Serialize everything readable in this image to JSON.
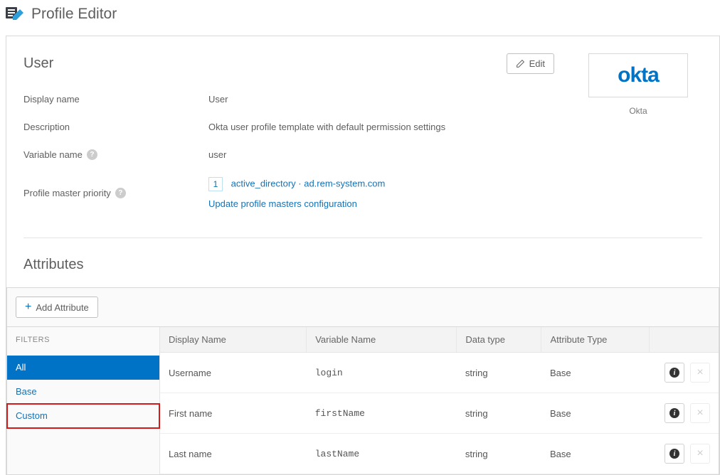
{
  "header": {
    "title": "Profile Editor"
  },
  "user": {
    "section_title": "User",
    "edit_label": "Edit",
    "fields": {
      "display_name_label": "Display name",
      "display_name_value": "User",
      "description_label": "Description",
      "description_value": "Okta user profile template with default permission settings",
      "variable_name_label": "Variable name",
      "variable_name_value": "user",
      "master_priority_label": "Profile master priority",
      "master_priority_num": "1",
      "master_priority_link": "active_directory · ad.rem-system.com",
      "master_priority_update": "Update profile masters configuration"
    }
  },
  "side": {
    "logo_text": "okta",
    "logo_caption": "Okta"
  },
  "attributes": {
    "title": "Attributes",
    "add_label": "Add Attribute",
    "filters_header": "FILTERS",
    "filters": [
      {
        "label": "All",
        "active": true,
        "highlighted": false
      },
      {
        "label": "Base",
        "active": false,
        "highlighted": false
      },
      {
        "label": "Custom",
        "active": false,
        "highlighted": true
      }
    ],
    "columns": {
      "display": "Display Name",
      "variable": "Variable Name",
      "datatype": "Data type",
      "attrtype": "Attribute Type"
    },
    "rows": [
      {
        "display": "Username",
        "variable": "login",
        "datatype": "string",
        "attrtype": "Base"
      },
      {
        "display": "First name",
        "variable": "firstName",
        "datatype": "string",
        "attrtype": "Base"
      },
      {
        "display": "Last name",
        "variable": "lastName",
        "datatype": "string",
        "attrtype": "Base"
      }
    ]
  }
}
